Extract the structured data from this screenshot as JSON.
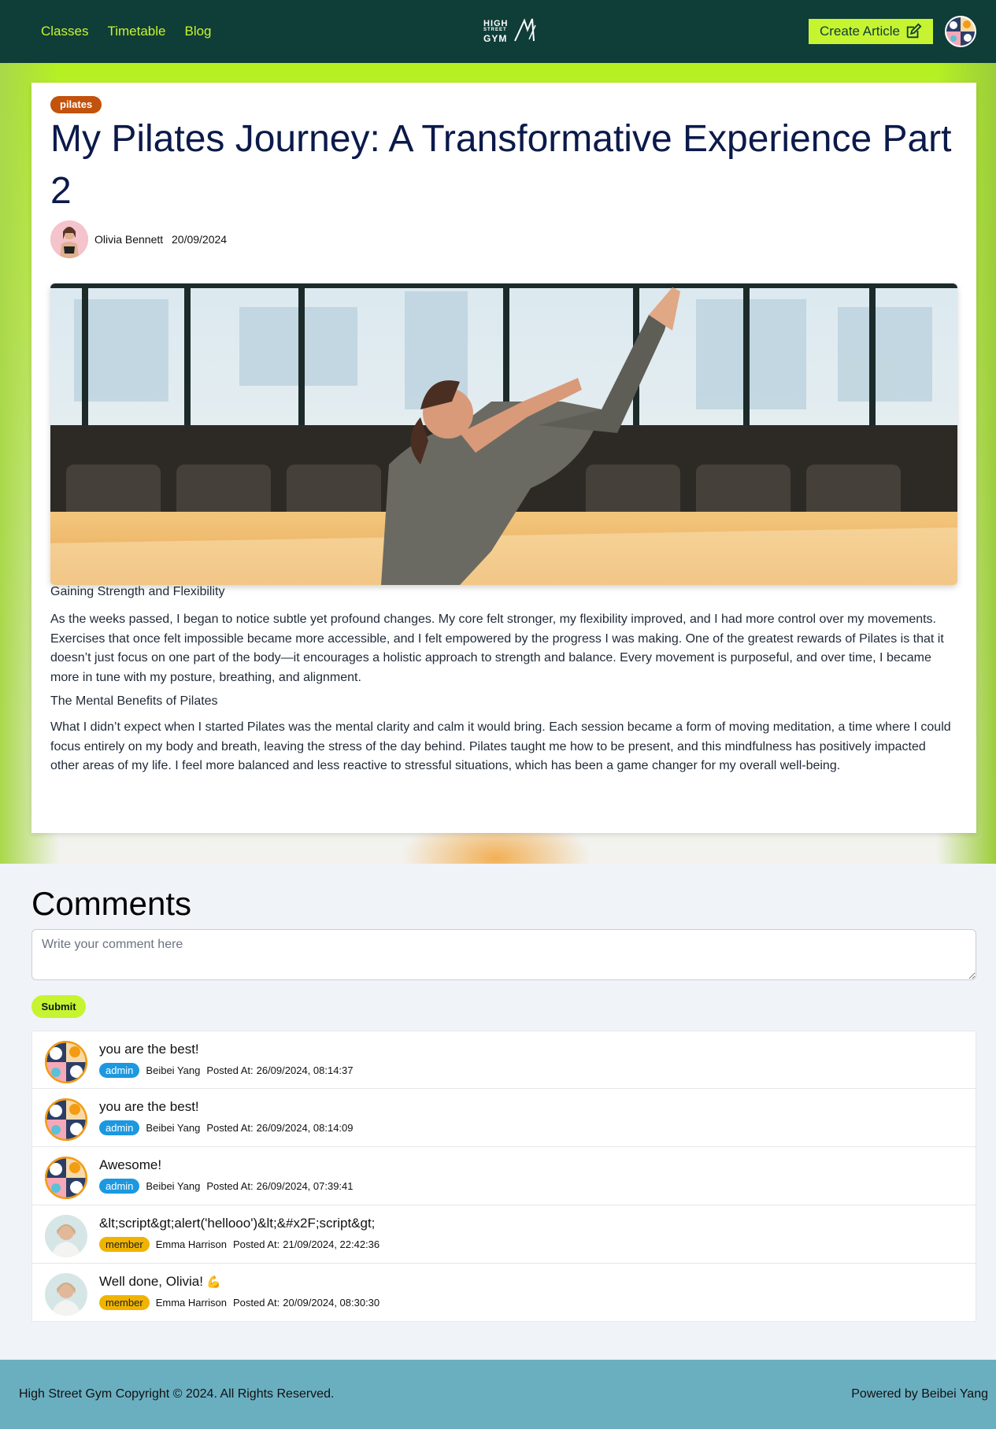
{
  "nav": {
    "links": [
      "Classes",
      "Timetable",
      "Blog"
    ],
    "logo": {
      "line1": "HIGH",
      "line2": "STREET",
      "line3": "GYM"
    },
    "create_label": "Create Article",
    "create_icon": "edit-icon",
    "avatar_icon": "cat-avatar-icon"
  },
  "article": {
    "tag": "pilates",
    "title": "My Pilates Journey: A Transformative Experience Part 2",
    "author": "Olivia Bennett",
    "date": "20/09/2024",
    "sections": [
      {
        "heading": "Gaining Strength and Flexibility",
        "text": "As the weeks passed, I began to notice subtle yet profound changes. My core felt stronger, my flexibility improved, and I had more control over my movements. Exercises that once felt impossible became more accessible, and I felt empowered by the progress I was making. One of the greatest rewards of Pilates is that it doesn’t just focus on one part of the body—it encourages a holistic approach to strength and balance. Every movement is purposeful, and over time, I became more in tune with my posture, breathing, and alignment."
      },
      {
        "heading": "The Mental Benefits of Pilates",
        "text": "What I didn’t expect when I started Pilates was the mental clarity and calm it would bring. Each session became a form of moving meditation, a time where I could focus entirely on my body and breath, leaving the stress of the day behind. Pilates taught me how to be present, and this mindfulness has positively impacted other areas of my life. I feel more balanced and less reactive to stressful situations, which has been a game changer for my overall well-being."
      }
    ]
  },
  "comments": {
    "title": "Comments",
    "placeholder": "Write your comment here",
    "submit_label": "Submit",
    "posted_prefix": "Posted At:",
    "items": [
      {
        "text": "you are the best!",
        "role": "admin",
        "author": "Beibei Yang",
        "posted": "26/09/2024, 08:14:37"
      },
      {
        "text": "you are the best!",
        "role": "admin",
        "author": "Beibei Yang",
        "posted": "26/09/2024, 08:14:09"
      },
      {
        "text": "Awesome!",
        "role": "admin",
        "author": "Beibei Yang",
        "posted": "26/09/2024, 07:39:41"
      },
      {
        "text": "&lt;script&gt;alert('hellooo')&lt;&#x2F;script&gt;",
        "role": "member",
        "author": "Emma Harrison",
        "posted": "21/09/2024, 22:42:36"
      },
      {
        "text": "Well done, Olivia!",
        "role": "member",
        "author": "Emma Harrison",
        "posted": "20/09/2024, 08:30:30",
        "emoji": "💪"
      }
    ]
  },
  "footer": {
    "copyright": "High Street Gym Copyright © 2024. All Rights Reserved.",
    "powered": "Powered by Beibei Yang"
  },
  "colors": {
    "nav_bg": "#0f3d37",
    "accent": "#c6f431",
    "tag_bg": "#c2520c",
    "admin_badge": "#1b98e0",
    "member_badge": "#f0b400",
    "footer_bg": "#6aafc0"
  }
}
